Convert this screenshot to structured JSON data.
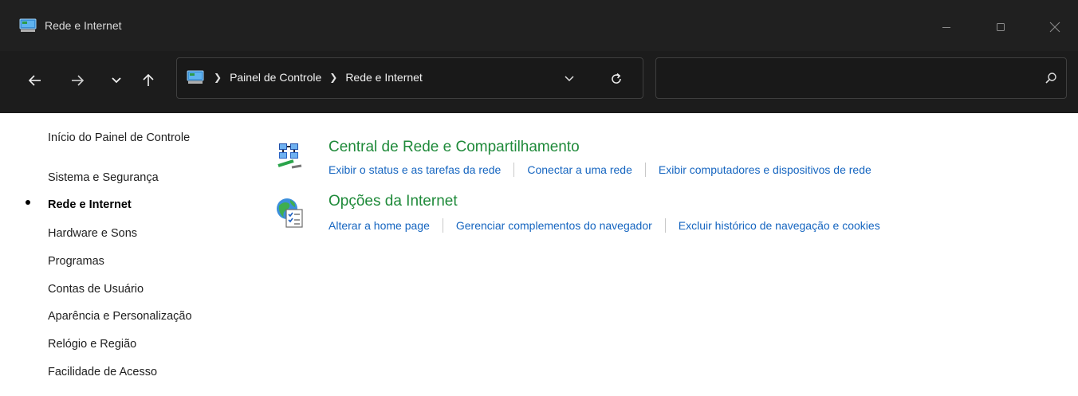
{
  "window": {
    "title": "Rede e Internet",
    "icon": "control-panel-icon"
  },
  "nav": {
    "back_icon": "arrow-left-icon",
    "forward_icon": "arrow-right-icon",
    "recent_icon": "chevron-down-icon",
    "up_icon": "arrow-up-icon"
  },
  "address": {
    "crumbs": [
      "Painel de Controle",
      "Rede e Internet"
    ],
    "dropdown_icon": "chevron-down-icon",
    "refresh_icon": "refresh-icon"
  },
  "search": {
    "value": "",
    "placeholder": "",
    "icon": "search-icon"
  },
  "sidebar": {
    "items": [
      {
        "label": "Início do Painel de Controle",
        "active": false
      },
      {
        "label": "Sistema e Segurança",
        "active": false
      },
      {
        "label": "Rede e Internet",
        "active": true
      },
      {
        "label": "Hardware e Sons",
        "active": false
      },
      {
        "label": "Programas",
        "active": false
      },
      {
        "label": "Contas de Usuário",
        "active": false
      },
      {
        "label": "Aparência e Personalização",
        "active": false
      },
      {
        "label": "Relógio e Região",
        "active": false
      },
      {
        "label": "Facilidade de Acesso",
        "active": false
      }
    ]
  },
  "categories": [
    {
      "title": "Central de Rede e Compartilhamento",
      "icon": "network-sharing-center-icon",
      "links": [
        "Exibir o status e as tarefas da rede",
        "Conectar a uma rede",
        "Exibir computadores e dispositivos de rede"
      ]
    },
    {
      "title": "Opções da Internet",
      "icon": "internet-options-icon",
      "links": [
        "Alterar a home page",
        "Gerenciar complementos do navegador",
        "Excluir histórico de navegação e cookies"
      ]
    }
  ],
  "colors": {
    "titlebar": "#202020",
    "navbar": "#1c1c1c",
    "category_title": "#1f8a3a",
    "link": "#1565c0"
  }
}
